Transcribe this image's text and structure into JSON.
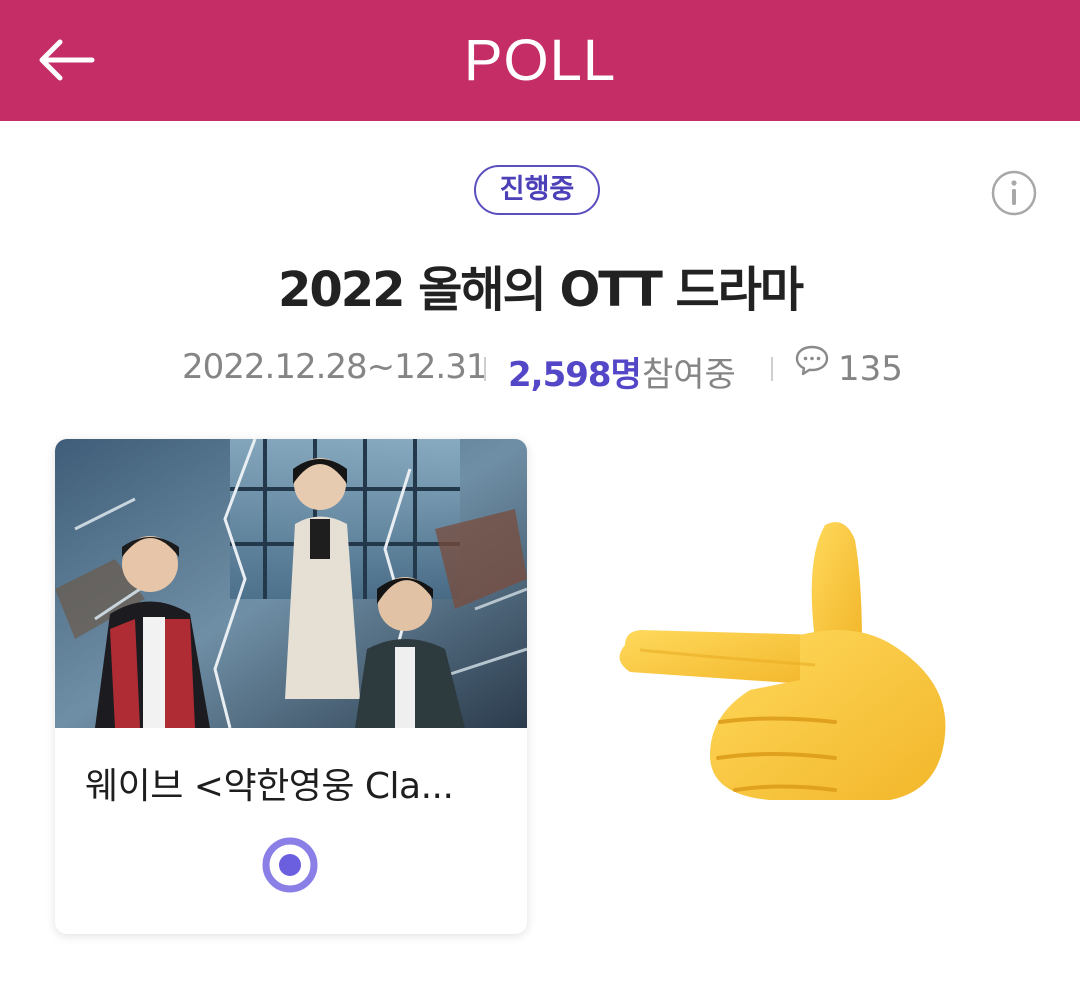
{
  "header": {
    "title": "POLL",
    "back_icon": "arrow-left-icon",
    "background": "#c42d66"
  },
  "poll": {
    "status": "진행중",
    "title": "2022 올해의 OTT 드라마",
    "period": "2022.12.28~12.31",
    "participants": "2,598명",
    "participants_suffix": "참여중",
    "comment_count": "135",
    "info_icon": "info-icon",
    "comment_icon": "speech-bubble-icon",
    "accent": "#5447c7"
  },
  "option": {
    "label": "웨이브 <약한영웅 Cla...",
    "image": "poster-photo",
    "selected": true
  },
  "decoration": {
    "pointer": "hand-pointing-left-emoji"
  }
}
